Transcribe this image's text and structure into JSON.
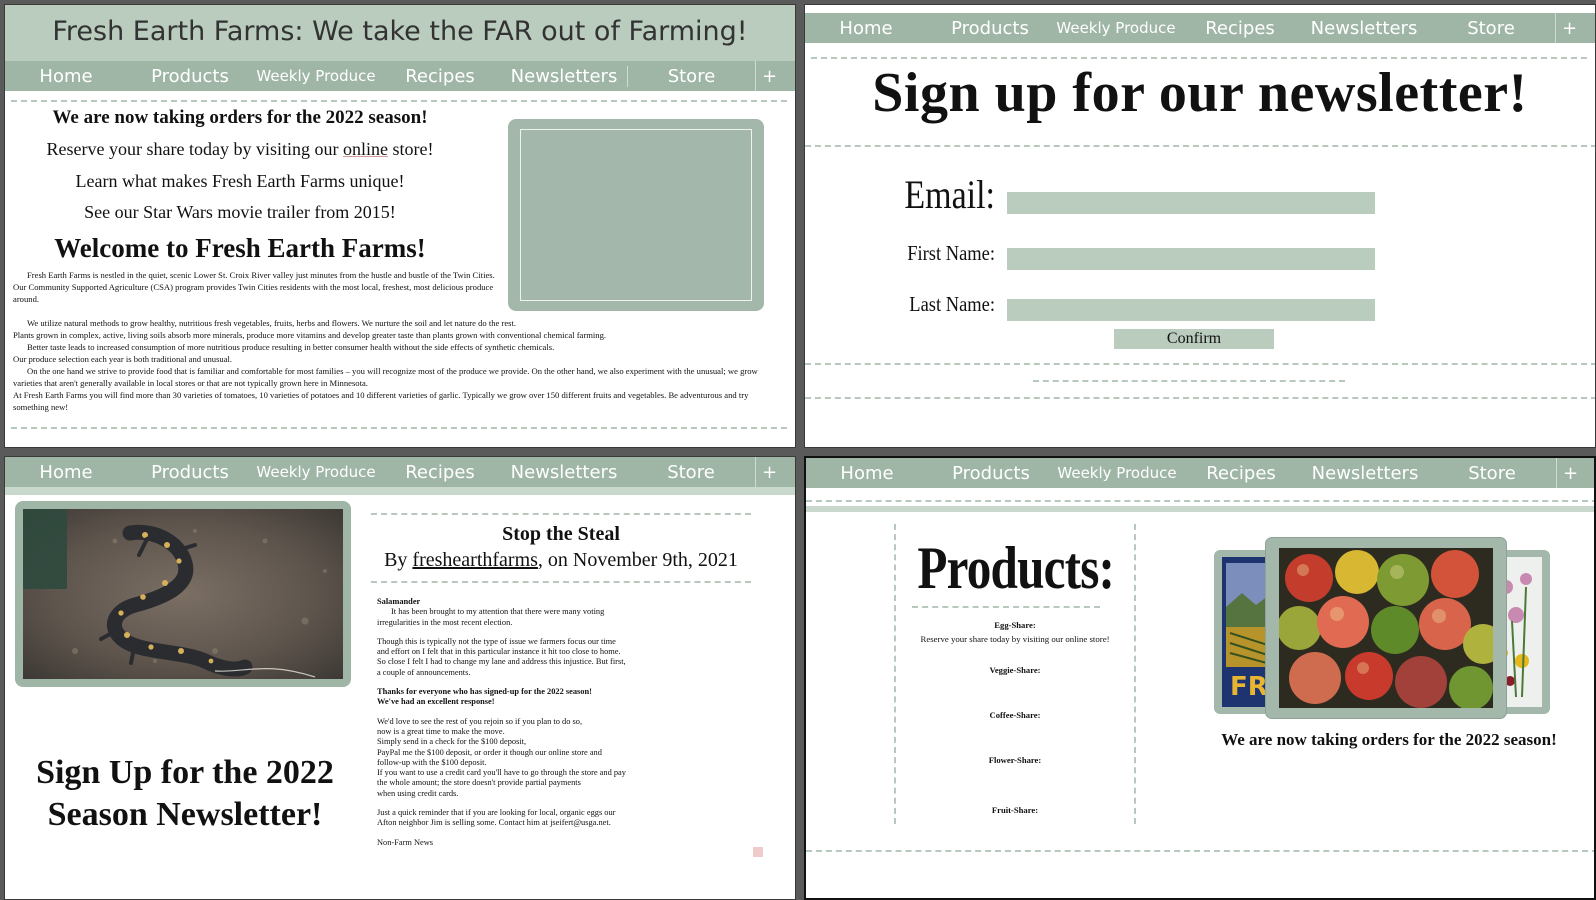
{
  "nav": {
    "items": [
      "Home",
      "Products",
      "Weekly Produce",
      "Recipes",
      "Newsletters",
      "Store"
    ],
    "more": "+"
  },
  "home": {
    "site_title": "Fresh Earth Farms:  We take the FAR out of Farming!",
    "orders_heading": "We are now taking orders for the 2022 season!",
    "reserve_prefix": "Reserve your share today by visiting our ",
    "reserve_link": "online",
    "reserve_suffix": " store!",
    "unique_link": "Learn what makes Fresh Earth Farms unique!",
    "trailer_link": "See our Star Wars movie trailer from 2015!",
    "welcome_heading": "Welcome to Fresh Earth Farms!",
    "paragraphs": [
      "Fresh Earth Farms is nestled in the quiet, scenic Lower St. Croix River valley just minutes from the hustle and bustle of the Twin Cities.  Our Community Supported Agriculture (CSA) program provides Twin Cities residents with the most local, freshest, most delicious produce around.",
      "We utilize natural methods to grow healthy, nutritious fresh vegetables, fruits, herbs and flowers.  We nurture the soil and let nature do the rest.",
      "Plants grown in complex, active, living soils absorb more minerals, produce more vitamins and develop greater taste than plants grown with conventional chemical farming.",
      "Better taste leads to increased consumption of more nutritious produce resulting in better consumer health without the side effects of synthetic chemicals.",
      "Our produce selection each year is both traditional and unusual.",
      "On the one hand we strive to provide food that is familiar and comfortable for most families – you will recognize most of the produce we provide.  On the other hand, we also experiment with the unusual; we grow varieties that aren't generally available in local stores or that are not typically grown here in Minnesota.",
      "At Fresh Earth Farms you will find more than 30 varieties of tomatoes, 10 varieties of potatoes and 10 different varieties of garlic.  Typically we grow over 150 different fruits and vegetables.  Be adventurous and try something new!"
    ]
  },
  "newsletter_signup": {
    "heading": "Sign up for our newsletter!",
    "email_label": "Email:",
    "first_name_label": "First Name:",
    "last_name_label": "Last Name:",
    "email_value": "",
    "first_name_value": "",
    "last_name_value": "",
    "confirm_label": "Confirm"
  },
  "blog": {
    "signup_heading": "Sign Up for the 2022 Season Newsletter!",
    "post_title": "Stop the Steal",
    "byline_prefix": "By ",
    "byline_author": "freshearthfarms",
    "byline_suffix": ", on November 9th, 2021",
    "body_lines": [
      "Salamander",
      "It has been brought to my attention that there were many voting",
      "irregularities in the most recent election.",
      "",
      "Though this is typically not the type of issue we farmers focus our time",
      "and effort on I felt that in this particular instance it hit too close to home.",
      "So close I felt I had to change my lane and address this injustice. But first,",
      "a couple of announcements.",
      "",
      "Thanks for everyone who has signed-up for the 2022 season!",
      "We've had an excellent response!",
      "",
      "We'd love to see the rest of you rejoin so if you plan to do so,",
      " now is a great time to make the move.",
      "Simply send in a check for the $100 deposit,",
      "PayPal me the $100 deposit, or order it though our online store and",
      "follow-up with the $100 deposit.",
      "If you want to use a credit card you'll have to go through the store and pay",
      " the whole amount; the store doesn't provide partial payments",
      "when using credit cards.",
      "",
      "Just a quick reminder that if you are looking for local, organic eggs our",
      "Afton neighbor Jim is selling some. Contact him at jseifert@usga.net.",
      "",
      "Non-Farm News"
    ]
  },
  "products": {
    "heading": "Products:",
    "egg_share": "Egg-Share:",
    "egg_note": "Reserve your share today by visiting our online store!",
    "veggie_share": "Veggie-Share:",
    "coffee_share": "Coffee-Share:",
    "flower_share": "Flower-Share:",
    "fruit_share": "Fruit-Share:",
    "caption": "We are now taking orders for the 2022 season!",
    "poster_text": "FR"
  },
  "colors": {
    "sage": "#9fb6a7",
    "sage_light": "#b9ccbe",
    "dash": "#b7c9bd"
  }
}
